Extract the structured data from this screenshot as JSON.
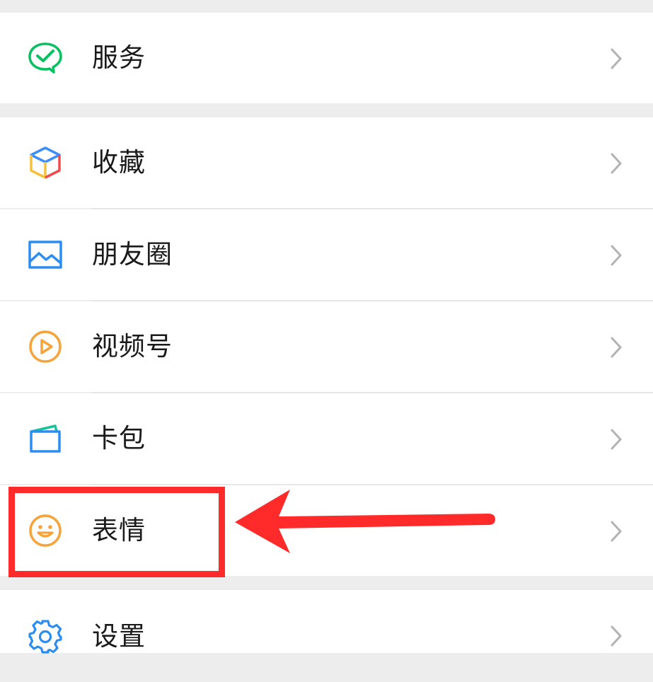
{
  "menu": {
    "items": [
      {
        "label": "服务",
        "icon": "wechat-pay-check-icon",
        "color": "#07c160"
      },
      {
        "label": "收藏",
        "icon": "cube-icon",
        "color": "#3e8ef7"
      },
      {
        "label": "朋友圈",
        "icon": "picture-icon",
        "color": "#2c8df0"
      },
      {
        "label": "视频号",
        "icon": "play-circle-icon",
        "color": "#f5a33b"
      },
      {
        "label": "卡包",
        "icon": "card-wallet-icon",
        "color": "#2c8df0"
      },
      {
        "label": "表情",
        "icon": "smiley-icon",
        "color": "#f5a33b"
      },
      {
        "label": "设置",
        "icon": "gear-icon",
        "color": "#2c8df0"
      }
    ]
  },
  "annotation": {
    "highlight_color": "#ff2b2b",
    "highlighted_item": "表情"
  }
}
